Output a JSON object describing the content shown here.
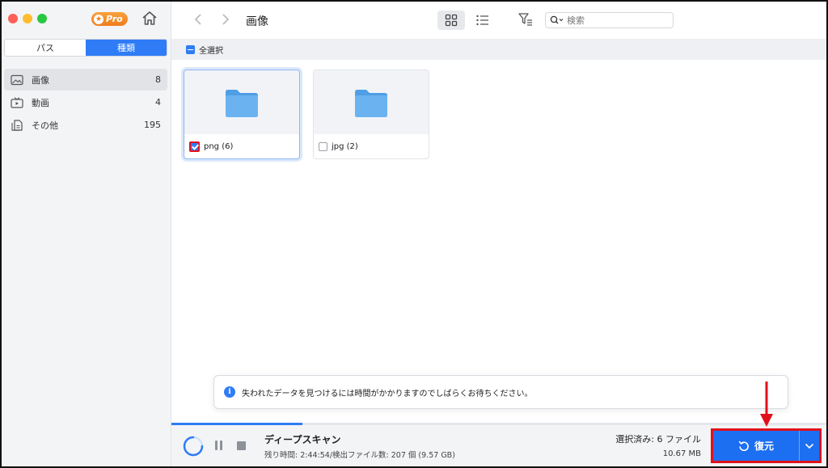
{
  "sidebar": {
    "pro_label": "Pro",
    "tabs": [
      {
        "label": "パス",
        "active": false
      },
      {
        "label": "種類",
        "active": true
      }
    ],
    "items": [
      {
        "label": "画像",
        "count": "8",
        "icon": "image-icon",
        "selected": true
      },
      {
        "label": "動画",
        "count": "4",
        "icon": "video-icon",
        "selected": false
      },
      {
        "label": "その他",
        "count": "195",
        "icon": "document-icon",
        "selected": false
      }
    ]
  },
  "toolbar": {
    "title": "画像",
    "search_placeholder": "検索"
  },
  "select_all_label": "全選択",
  "folders": [
    {
      "label": "png (6)",
      "checked": true
    },
    {
      "label": "jpg (2)",
      "checked": false
    }
  ],
  "toast": {
    "message": "失われたデータを見つけるには時間がかかりますのでしばらくお待ちください。"
  },
  "status": {
    "scan_title": "ディープスキャン",
    "scan_detail": "残り時間: 2:44:54/検出ファイル数: 207 個 (9.57 GB)",
    "progress_fraction": 0.2,
    "selected_files": "選択済み: 6 ファイル",
    "selected_size": "10.67 MB",
    "recover_label": "復元"
  },
  "colors": {
    "accent": "#2f7cf6",
    "recover_button": "#1d6ff2",
    "annotation": "#e0111a",
    "folder": "#5aa8ea"
  }
}
